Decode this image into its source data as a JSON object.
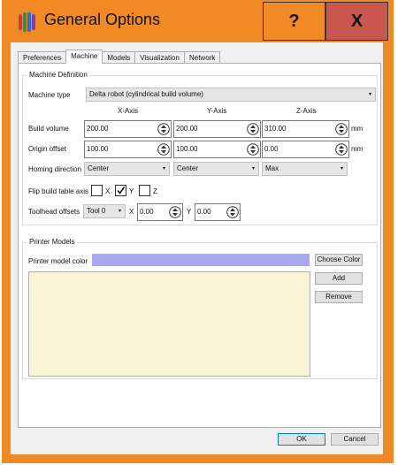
{
  "window": {
    "title": "General Options",
    "help_label": "?",
    "close_label": "X",
    "frame_color": "#f08a24",
    "close_color": "#c8584f"
  },
  "tabs": [
    {
      "label": "Preferences",
      "active": false
    },
    {
      "label": "Machine",
      "active": true
    },
    {
      "label": "Models",
      "active": false
    },
    {
      "label": "Visualization",
      "active": false
    },
    {
      "label": "Network",
      "active": false
    }
  ],
  "machine_definition": {
    "title": "Machine Definition",
    "machine_type_label": "Machine type",
    "machine_type_value": "Delta robot (cylindrical build volume)",
    "axis_headers": [
      "X-Axis",
      "Y-Axis",
      "Z-Axis"
    ],
    "build_volume": {
      "label": "Build volume",
      "values": [
        "200.00",
        "200.00",
        "310.00"
      ],
      "unit": "mm"
    },
    "origin_offset": {
      "label": "Origin offset",
      "values": [
        "100.00",
        "100.00",
        "0.00"
      ],
      "unit": "mm"
    },
    "homing_direction": {
      "label": "Homing direction",
      "values": [
        "Center",
        "Center",
        "Max"
      ]
    },
    "flip_build_table": {
      "label": "Flip build table axis",
      "axes": [
        {
          "label": "X",
          "checked": false
        },
        {
          "label": "Y",
          "checked": true
        },
        {
          "label": "Z",
          "checked": false
        }
      ]
    },
    "toolhead_offsets": {
      "label": "Toolhead offsets",
      "tool_value": "Tool 0",
      "x_label": "X",
      "x_value": "0.00",
      "y_label": "Y",
      "y_value": "0.00"
    }
  },
  "printer_models": {
    "title": "Printer Models",
    "color_label": "Printer model color",
    "color_value": "#a9a9f2",
    "list_color": "#fbf3d6",
    "choose_color_label": "Choose Color",
    "add_label": "Add",
    "remove_label": "Remove"
  },
  "footer": {
    "ok_label": "OK",
    "cancel_label": "Cancel"
  }
}
